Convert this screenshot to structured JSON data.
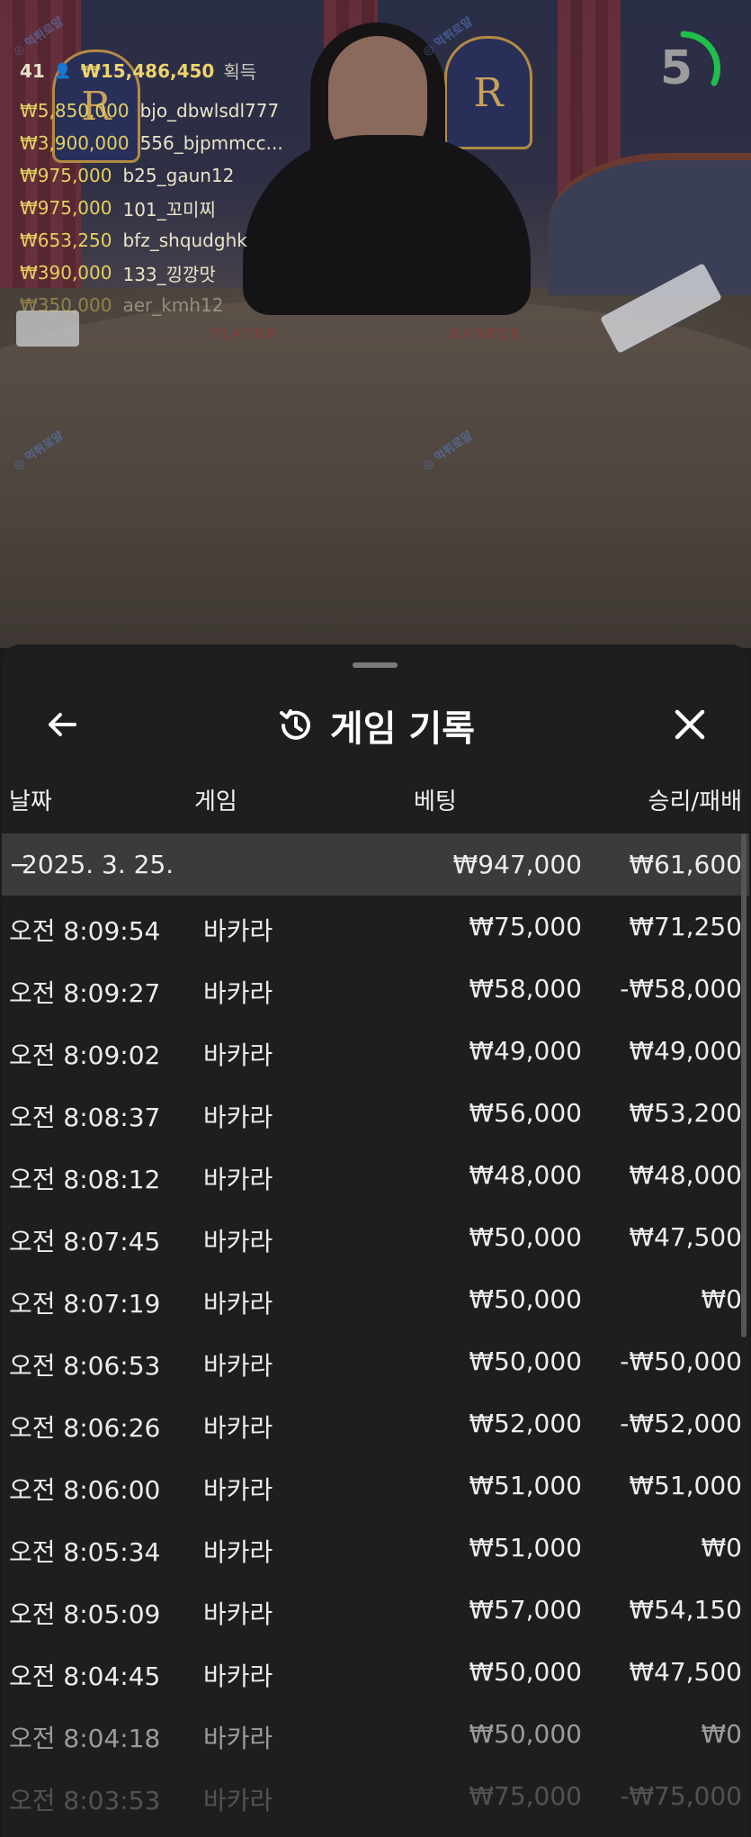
{
  "live": {
    "timer_value": "5",
    "timer_color": "#1fbf4a",
    "winners_header": {
      "count": "41",
      "total": "₩15,486,450",
      "label": "획득"
    },
    "winners": [
      {
        "amount": "₩5,850,000",
        "name": "bjo_dbwlsdl777"
      },
      {
        "amount": "₩3,900,000",
        "name": "556_bjpmmcc..."
      },
      {
        "amount": "₩975,000",
        "name": "b25_gaun12"
      },
      {
        "amount": "₩975,000",
        "name": "101_꼬미찌"
      },
      {
        "amount": "₩653,250",
        "name": "bfz_shqudghk"
      },
      {
        "amount": "₩390,000",
        "name": "133_낑깡맛"
      },
      {
        "amount": "₩350,000",
        "name": "aer_kmh12"
      }
    ],
    "table_labels": {
      "player": "PLAYER",
      "banker": "BANKER"
    }
  },
  "sheet": {
    "title": "게임 기록",
    "columns": {
      "date": "날짜",
      "game": "게임",
      "bet": "베팅",
      "result": "승리/패배"
    },
    "date_row": {
      "date": "2025. 3. 25.",
      "bet": "₩947,000",
      "result": "₩61,600"
    },
    "rows": [
      {
        "time": "오전 8:09:54",
        "game": "바카라",
        "bet": "₩75,000",
        "result": "₩71,250"
      },
      {
        "time": "오전 8:09:27",
        "game": "바카라",
        "bet": "₩58,000",
        "result": "-₩58,000"
      },
      {
        "time": "오전 8:09:02",
        "game": "바카라",
        "bet": "₩49,000",
        "result": "₩49,000"
      },
      {
        "time": "오전 8:08:37",
        "game": "바카라",
        "bet": "₩56,000",
        "result": "₩53,200"
      },
      {
        "time": "오전 8:08:12",
        "game": "바카라",
        "bet": "₩48,000",
        "result": "₩48,000"
      },
      {
        "time": "오전 8:07:45",
        "game": "바카라",
        "bet": "₩50,000",
        "result": "₩47,500"
      },
      {
        "time": "오전 8:07:19",
        "game": "바카라",
        "bet": "₩50,000",
        "result": "₩0"
      },
      {
        "time": "오전 8:06:53",
        "game": "바카라",
        "bet": "₩50,000",
        "result": "-₩50,000"
      },
      {
        "time": "오전 8:06:26",
        "game": "바카라",
        "bet": "₩52,000",
        "result": "-₩52,000"
      },
      {
        "time": "오전 8:06:00",
        "game": "바카라",
        "bet": "₩51,000",
        "result": "₩51,000"
      },
      {
        "time": "오전 8:05:34",
        "game": "바카라",
        "bet": "₩51,000",
        "result": "₩0"
      },
      {
        "time": "오전 8:05:09",
        "game": "바카라",
        "bet": "₩57,000",
        "result": "₩54,150"
      },
      {
        "time": "오전 8:04:45",
        "game": "바카라",
        "bet": "₩50,000",
        "result": "₩47,500"
      },
      {
        "time": "오전 8:04:18",
        "game": "바카라",
        "bet": "₩50,000",
        "result": "₩0"
      },
      {
        "time": "오전 8:03:53",
        "game": "바카라",
        "bet": "₩75,000",
        "result": "-₩75,000"
      }
    ]
  },
  "icons": {
    "back": "arrow-left-icon",
    "history": "history-clock-icon",
    "close": "close-icon"
  }
}
